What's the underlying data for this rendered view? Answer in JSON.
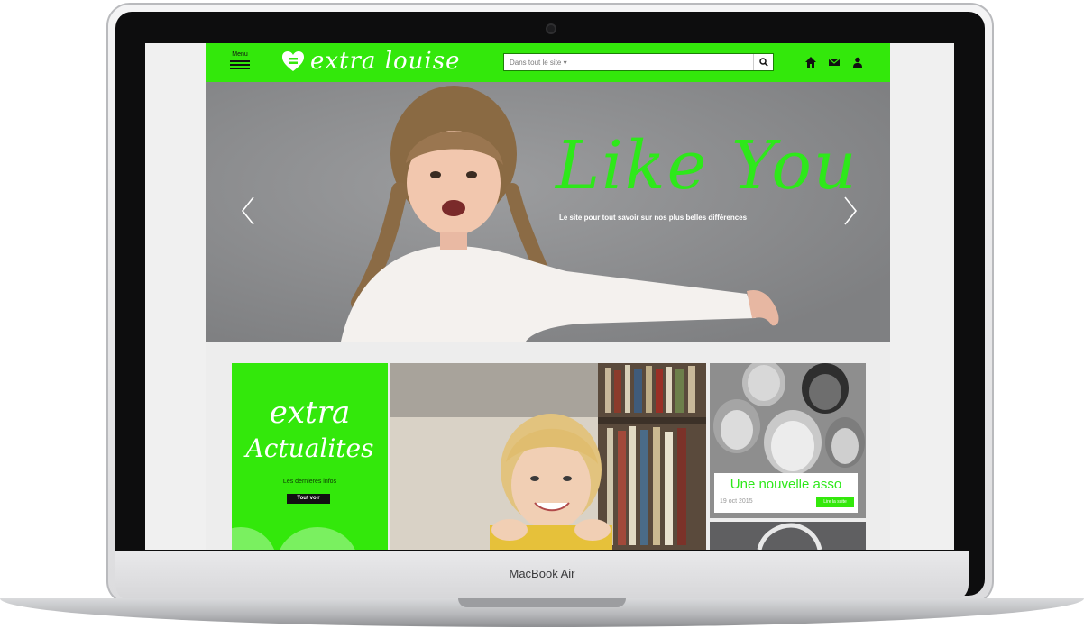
{
  "device": {
    "brand_label": "MacBook Air"
  },
  "header": {
    "menu_label": "Menu",
    "logo_text": "extra louise",
    "search_scope": "Dans tout le site ▾",
    "search_placeholder": "",
    "icons": [
      "search-icon",
      "home-icon",
      "mail-icon",
      "user-icon"
    ]
  },
  "hero": {
    "title": "Like You",
    "subtitle": "Le site pour tout savoir sur nos plus belles différences"
  },
  "news_tile": {
    "title_line1": "extra",
    "title_line2": "Actualites",
    "subtitle": "Les dernieres infos",
    "button": "Tout voir"
  },
  "asso_card": {
    "title": "Une nouvelle asso",
    "date": "19 oct 2015",
    "button": "Lire la suite"
  },
  "colors": {
    "brand_green": "#33e80b",
    "accent_green": "#2ee81a"
  }
}
